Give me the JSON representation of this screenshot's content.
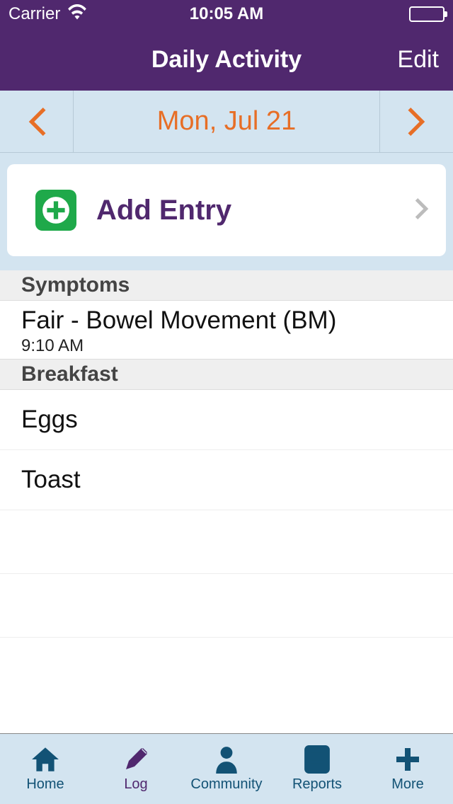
{
  "status": {
    "carrier": "Carrier",
    "time": "10:05 AM"
  },
  "nav": {
    "title": "Daily Activity",
    "edit": "Edit"
  },
  "date": {
    "label": "Mon, Jul 21"
  },
  "addEntry": {
    "label": "Add Entry"
  },
  "sections": [
    {
      "title": "Symptoms",
      "entries": [
        {
          "title": "Fair - Bowel Movement (BM)",
          "time": "9:10 AM"
        }
      ]
    },
    {
      "title": "Breakfast",
      "items": [
        "Eggs",
        "Toast"
      ]
    }
  ],
  "tabs": [
    {
      "label": "Home"
    },
    {
      "label": "Log"
    },
    {
      "label": "Community"
    },
    {
      "label": "Reports"
    },
    {
      "label": "More"
    }
  ]
}
